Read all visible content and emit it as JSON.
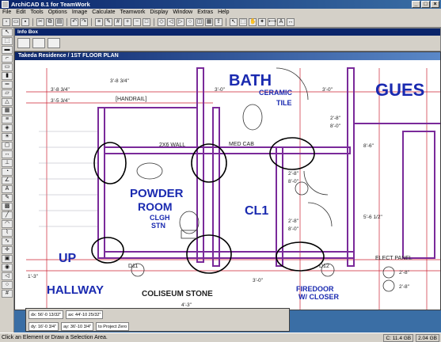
{
  "app": {
    "title": "ArchiCAD 8.1 for TeamWork"
  },
  "menu": [
    "File",
    "Edit",
    "Tools",
    "Options",
    "Image",
    "Calculate",
    "Teamwork",
    "Display",
    "Window",
    "Extras",
    "Help"
  ],
  "infobox": {
    "title": "Info Box"
  },
  "plan_window": {
    "title": "Takeda Residence / 1ST FLOOR PLAN",
    "labels": {
      "bath": "BATH",
      "ceramic": "CERAMIC",
      "tile": "TILE",
      "gues": "GUES",
      "handrail": "[HANDRAIL]",
      "wall_2x6": "2X6 WALL",
      "med_cab": "MED CAB",
      "powder": "POWDER",
      "room": "ROOM",
      "clgh": "CLGH",
      "stn": "STN",
      "cl1": "CL1",
      "up": "UP",
      "hallway": "HALLWAY",
      "coliseum_stone": "COLISEUM STONE",
      "fire_door": "FIREDOOR",
      "closer": "W/ CLOSER",
      "elect_panel": "ELECT PANEL",
      "d11": "D11",
      "d12": "D12",
      "dim_3_8_3_4_a": "3'-8 3/4\"",
      "dim_3_8_3_4_b": "3'-8 3/4\"",
      "dim_3_0_a": "3'-0\"",
      "dim_3_0_b": "3'-0\"",
      "dim_2_8": "2'-8\"",
      "dim_8_0_a": "8'-0\"",
      "dim_8_0_b": "8'-0\"",
      "dim_2_8_b": "2'-8\"",
      "dim_2_8_c": "2'-8\"",
      "dim_8_0_c": "8'-0\"",
      "dim_2_8_d": "2'-8\"",
      "dim_2_8_e": "2'-8\"",
      "dim_1_3": "1'-3\"",
      "dim_4_3": "4'-3\"",
      "dim_3_0_c": "3'-0\"",
      "dim_5_6": "5'-6 1/2\"",
      "dim_8_6": "8'-6\"",
      "dim_5_3": "3'-5 3/4\""
    }
  },
  "coordbox": {
    "dx": "dx: 56'-0 13/32\"",
    "dy": "dy: 16'-0 3/4\"",
    "ax": "ax: 44'-10 25/32\"",
    "ay": "ay: 36'-10 3/4\"",
    "angle": "to Project Zero"
  },
  "status": {
    "message": "Click an Element or Draw a Selection Area.",
    "memory": "C: 11.4 GB",
    "disk": "2.04 GB"
  }
}
